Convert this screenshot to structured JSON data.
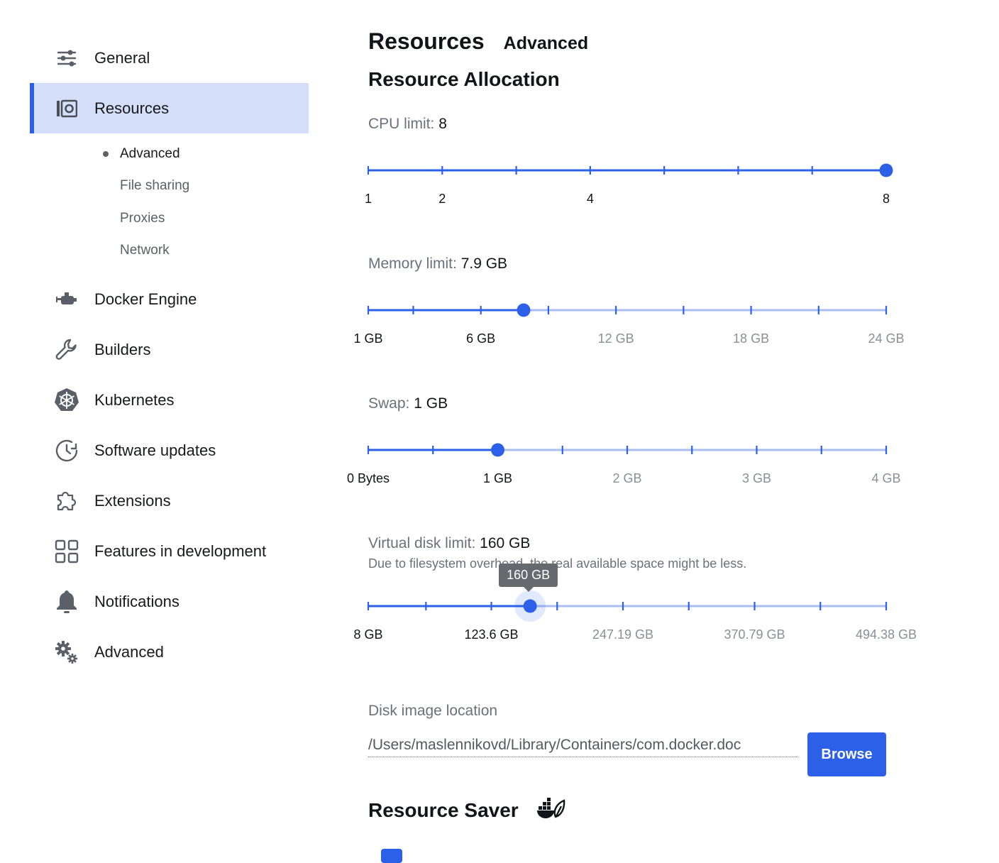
{
  "sidebar": {
    "items": [
      {
        "label": "General",
        "icon": "sliders-icon"
      },
      {
        "label": "Resources",
        "icon": "resources-icon",
        "active": true
      },
      {
        "label": "Docker Engine",
        "icon": "engine-icon"
      },
      {
        "label": "Builders",
        "icon": "wrench-icon"
      },
      {
        "label": "Kubernetes",
        "icon": "kubernetes-icon"
      },
      {
        "label": "Software updates",
        "icon": "clock-update-icon"
      },
      {
        "label": "Extensions",
        "icon": "puzzle-icon"
      },
      {
        "label": "Features in development",
        "icon": "grid-icon"
      },
      {
        "label": "Notifications",
        "icon": "bell-icon"
      },
      {
        "label": "Advanced",
        "icon": "gears-icon"
      }
    ],
    "subitems": [
      {
        "label": "Advanced",
        "current": true
      },
      {
        "label": "File sharing"
      },
      {
        "label": "Proxies"
      },
      {
        "label": "Network"
      }
    ]
  },
  "header": {
    "title": "Resources",
    "tab": "Advanced"
  },
  "allocation": {
    "title": "Resource Allocation",
    "cpu": {
      "label": "CPU limit:",
      "value": "8",
      "min": 1,
      "max": 8,
      "current": 8,
      "ticks": [
        1,
        2,
        3,
        4,
        5,
        6,
        7,
        8
      ],
      "tick_labels": [
        {
          "at": 1,
          "text": "1"
        },
        {
          "at": 2,
          "text": "2"
        },
        {
          "at": 4,
          "text": "4"
        },
        {
          "at": 8,
          "text": "8"
        }
      ]
    },
    "memory": {
      "label": "Memory limit:",
      "value": "7.9 GB",
      "min": 1,
      "max": 24,
      "current": 7.9,
      "ticks": [
        1,
        3,
        6,
        9,
        12,
        15,
        18,
        21,
        24
      ],
      "tick_labels": [
        {
          "at": 1,
          "text": "1 GB"
        },
        {
          "at": 6,
          "text": "6 GB"
        },
        {
          "at": 12,
          "text": "12 GB"
        },
        {
          "at": 18,
          "text": "18 GB"
        },
        {
          "at": 24,
          "text": "24 GB"
        }
      ]
    },
    "swap": {
      "label": "Swap:",
      "value": "1 GB",
      "min": 0,
      "max": 4,
      "current": 1,
      "ticks": [
        0,
        0.5,
        1,
        1.5,
        2,
        2.5,
        3,
        3.5,
        4
      ],
      "tick_labels": [
        {
          "at": 0,
          "text": "0 Bytes"
        },
        {
          "at": 1,
          "text": "1 GB"
        },
        {
          "at": 2,
          "text": "2 GB"
        },
        {
          "at": 3,
          "text": "3 GB"
        },
        {
          "at": 4,
          "text": "4 GB"
        }
      ]
    },
    "disk": {
      "label": "Virtual disk limit:",
      "value": "160 GB",
      "note": "Due to filesystem overhead, the real available space might be less.",
      "tooltip": "160 GB",
      "min": 8,
      "max": 494.38,
      "current": 160,
      "ticks": [
        8,
        62.2,
        123.6,
        185.4,
        247.19,
        308.99,
        370.79,
        432.58,
        494.38
      ],
      "tick_labels": [
        {
          "at": 8,
          "text": "8 GB"
        },
        {
          "at": 123.6,
          "text": "123.6 GB"
        },
        {
          "at": 247.19,
          "text": "247.19 GB"
        },
        {
          "at": 370.79,
          "text": "370.79 GB"
        },
        {
          "at": 494.38,
          "text": "494.38 GB"
        }
      ]
    }
  },
  "disk_image": {
    "label": "Disk image location",
    "path": "/Users/maslennikovd/Library/Containers/com.docker.doc",
    "browse_label": "Browse"
  },
  "resource_saver": {
    "title": "Resource Saver",
    "icon": "docker-leaf-icon"
  },
  "colors": {
    "accent": "#2c60e8",
    "track_inactive": "#a9bdf3",
    "active_bg": "#d5def9"
  }
}
